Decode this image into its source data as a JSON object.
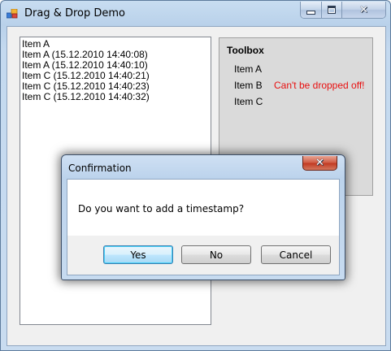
{
  "window": {
    "title": "Drag & Drop Demo",
    "minimize_glyph": "minimize-icon",
    "maximize_glyph": "maximize-icon",
    "close_glyph": "✕"
  },
  "listbox": {
    "items": [
      "Item A",
      "Item A (15.12.2010 14:40:08)",
      "Item A (15.12.2010 14:40:10)",
      "Item C (15.12.2010 14:40:21)",
      "Item C (15.12.2010 14:40:23)",
      "Item C (15.12.2010 14:40:32)"
    ]
  },
  "toolbox": {
    "title": "Toolbox",
    "items": [
      "Item A",
      "Item B",
      "Item C"
    ],
    "warning": "Can't be dropped off!",
    "warning_color": "#e81010"
  },
  "dialog": {
    "title": "Confirmation",
    "close_glyph": "✕",
    "message": "Do you want to add a timestamp?",
    "yes_label": "Yes",
    "no_label": "No",
    "cancel_label": "Cancel"
  }
}
